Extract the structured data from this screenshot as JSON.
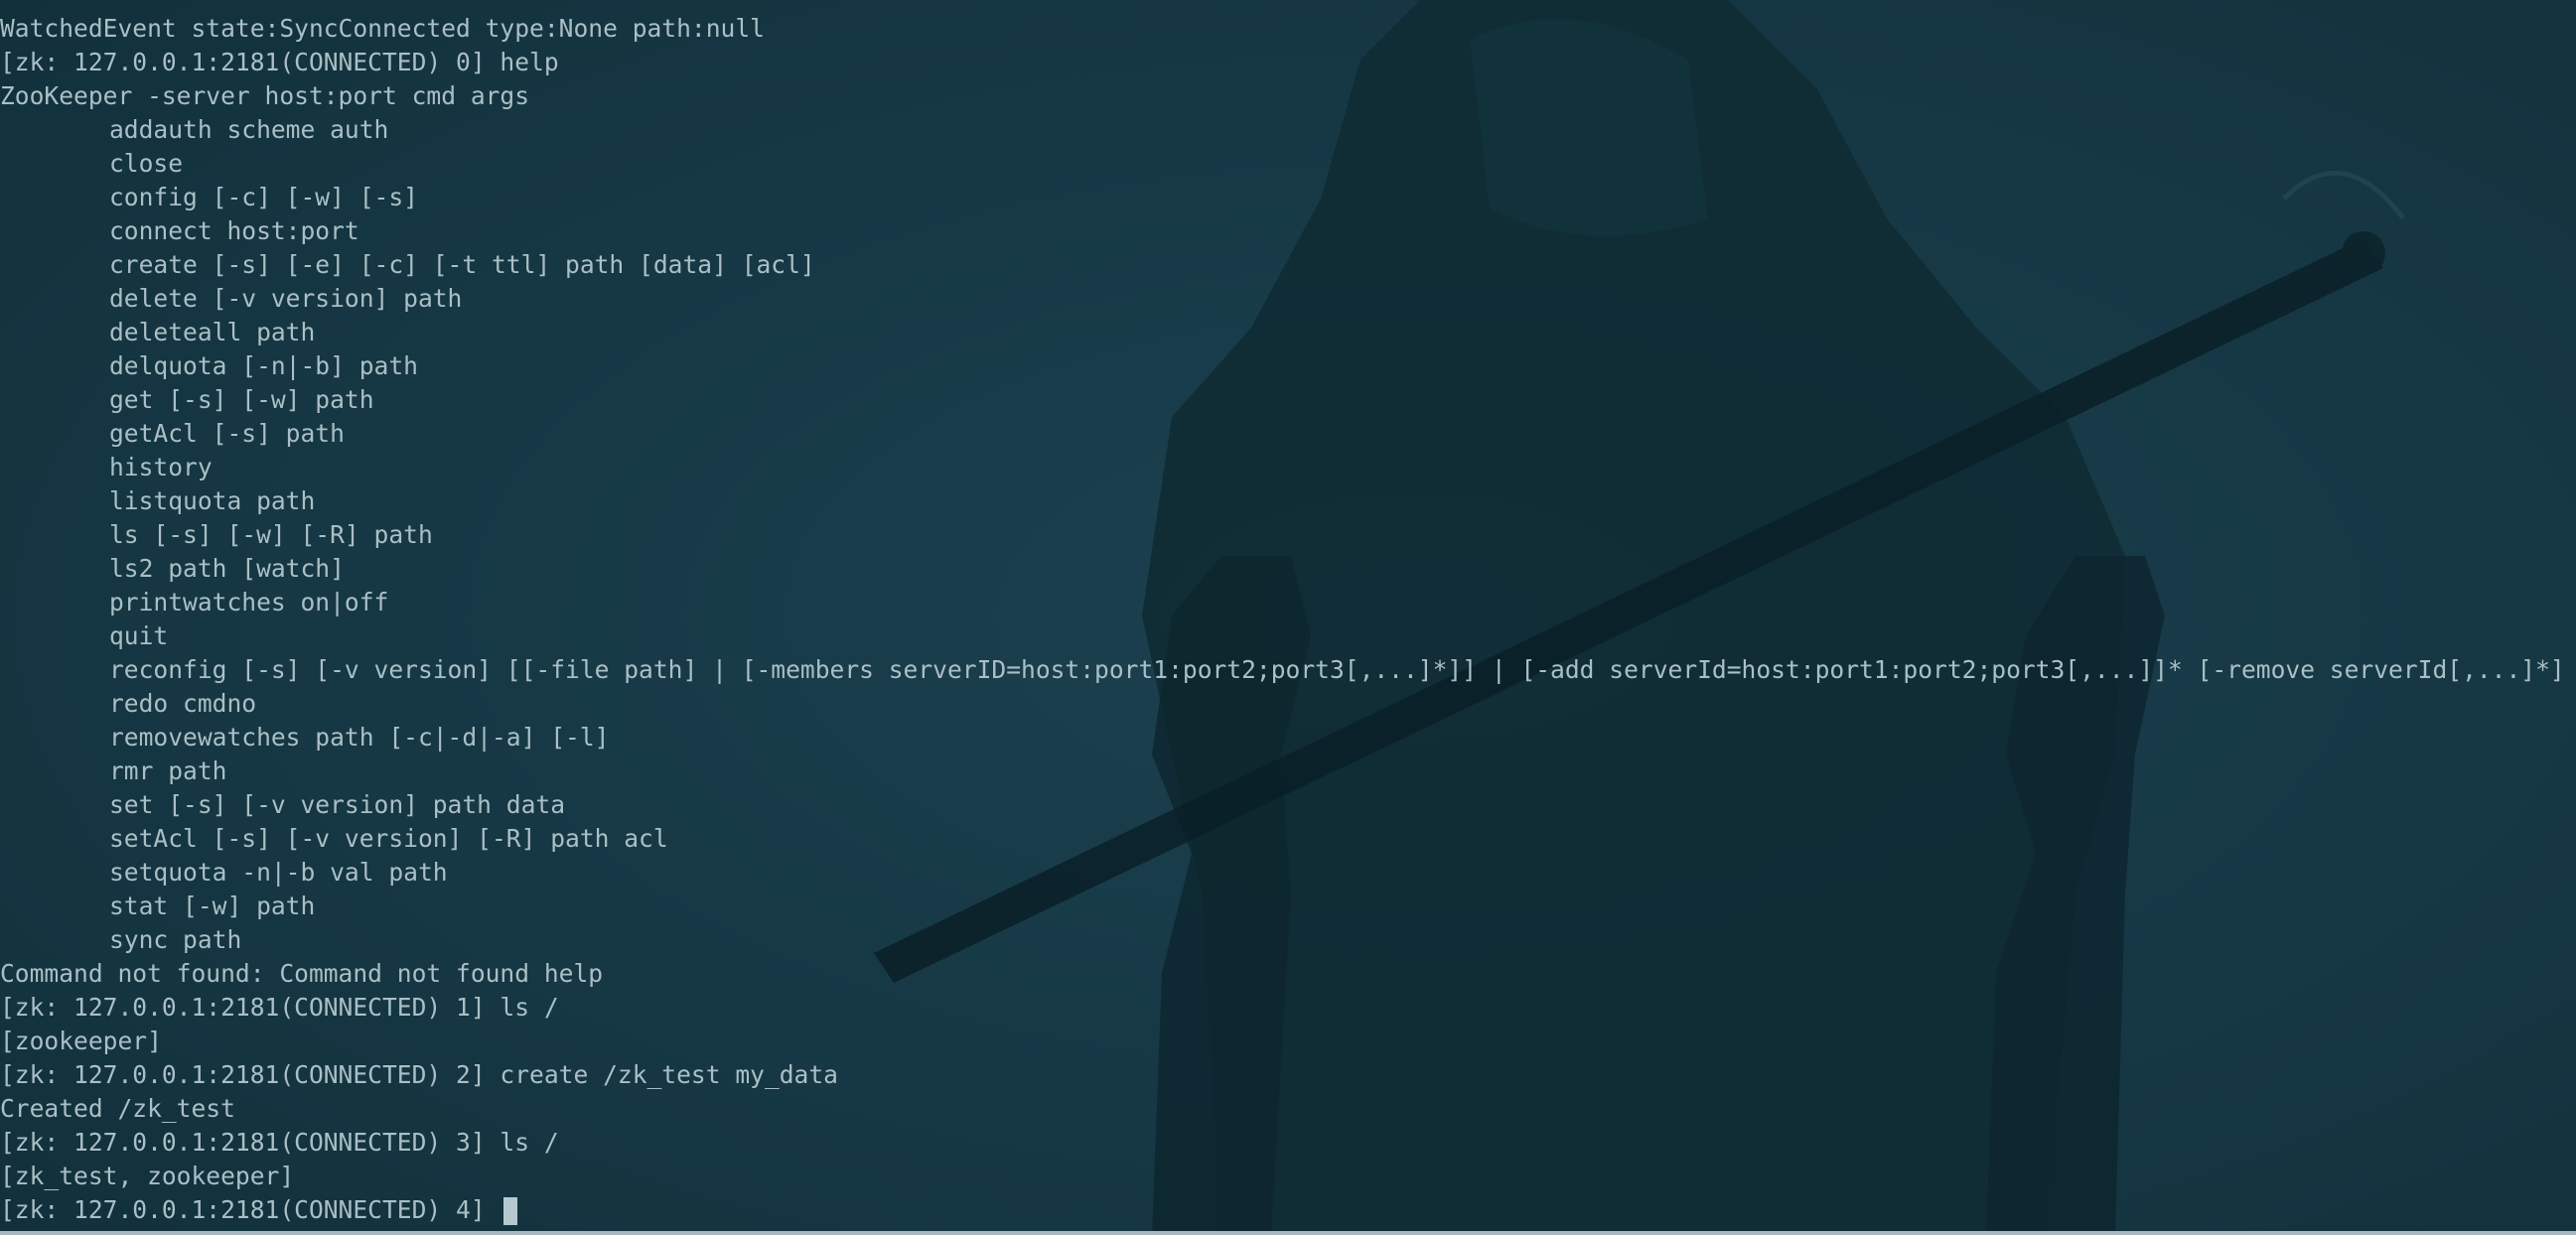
{
  "terminal": {
    "lines": [
      {
        "text": "WatchedEvent state:SyncConnected type:None path:null",
        "indent": false
      },
      {
        "text": "[zk: 127.0.0.1:2181(CONNECTED) 0] help",
        "indent": false
      },
      {
        "text": "ZooKeeper -server host:port cmd args",
        "indent": false
      },
      {
        "text": "addauth scheme auth",
        "indent": true
      },
      {
        "text": "close",
        "indent": true
      },
      {
        "text": "config [-c] [-w] [-s]",
        "indent": true
      },
      {
        "text": "connect host:port",
        "indent": true
      },
      {
        "text": "create [-s] [-e] [-c] [-t ttl] path [data] [acl]",
        "indent": true
      },
      {
        "text": "delete [-v version] path",
        "indent": true
      },
      {
        "text": "deleteall path",
        "indent": true
      },
      {
        "text": "delquota [-n|-b] path",
        "indent": true
      },
      {
        "text": "get [-s] [-w] path",
        "indent": true
      },
      {
        "text": "getAcl [-s] path",
        "indent": true
      },
      {
        "text": "history",
        "indent": true
      },
      {
        "text": "listquota path",
        "indent": true
      },
      {
        "text": "ls [-s] [-w] [-R] path",
        "indent": true
      },
      {
        "text": "ls2 path [watch]",
        "indent": true
      },
      {
        "text": "printwatches on|off",
        "indent": true
      },
      {
        "text": "quit",
        "indent": true
      },
      {
        "text": "reconfig [-s] [-v version] [[-file path] | [-members serverID=host:port1:port2;port3[,...]*]] | [-add serverId=host:port1:port2;port3[,...]]* [-remove serverId[,...]*]",
        "indent": true
      },
      {
        "text": "redo cmdno",
        "indent": true
      },
      {
        "text": "removewatches path [-c|-d|-a] [-l]",
        "indent": true
      },
      {
        "text": "rmr path",
        "indent": true
      },
      {
        "text": "set [-s] [-v version] path data",
        "indent": true
      },
      {
        "text": "setAcl [-s] [-v version] [-R] path acl",
        "indent": true
      },
      {
        "text": "setquota -n|-b val path",
        "indent": true
      },
      {
        "text": "stat [-w] path",
        "indent": true
      },
      {
        "text": "sync path",
        "indent": true
      },
      {
        "text": "Command not found: Command not found help",
        "indent": false
      },
      {
        "text": "[zk: 127.0.0.1:2181(CONNECTED) 1] ls /",
        "indent": false
      },
      {
        "text": "[zookeeper]",
        "indent": false
      },
      {
        "text": "[zk: 127.0.0.1:2181(CONNECTED) 2] create /zk_test my_data",
        "indent": false
      },
      {
        "text": "Created /zk_test",
        "indent": false
      },
      {
        "text": "[zk: 127.0.0.1:2181(CONNECTED) 3] ls /",
        "indent": false
      },
      {
        "text": "[zk_test, zookeeper]",
        "indent": false
      }
    ],
    "prompt": "[zk: 127.0.0.1:2181(CONNECTED) 4] ",
    "input_value": ""
  },
  "colors": {
    "background": "#173a47",
    "text": "#aabfc5",
    "cursor": "#b7c9ce"
  }
}
